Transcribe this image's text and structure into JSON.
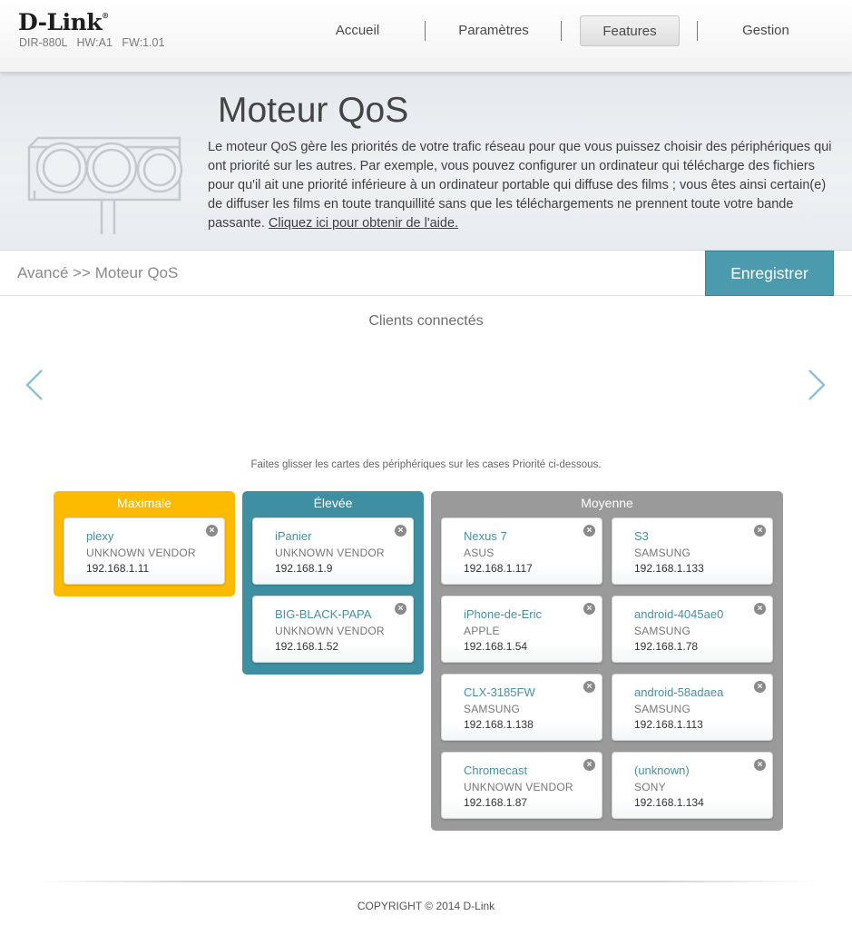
{
  "header": {
    "brand": "D-Link",
    "trademark": "®",
    "model": "DIR-880L",
    "hw": "HW:A1",
    "fw": "FW:1.01",
    "nav": [
      {
        "label": "Accueil"
      },
      {
        "label": "Paramètres"
      },
      {
        "label": "Features",
        "active": true
      },
      {
        "label": "Gestion"
      }
    ]
  },
  "intro": {
    "title": "Moteur QoS",
    "description": "Le moteur QoS gère les priorités de votre trafic réseau pour que vous puissez choisir des périphériques qui ont priorité sur les autres. Par exemple, vous pouvez configurer un ordinateur qui télécharge des fichiers pour qu'il ait une priorité inférieure à un ordinateur portable qui diffuse des films ; vous êtes ainsi certain(e) de diffuser les films en toute tranquillité sans que les téléchargements ne prennent toute votre bande passante.",
    "help_link": "Cliquez ici pour obtenir de l'aide.",
    "icon": "traffic-light-icon"
  },
  "breadcrumb": "Avancé >> Moteur QoS",
  "save_label": "Enregistrer",
  "clients": {
    "title": "Clients connectés",
    "prev_icon": "chevron-left-icon",
    "next_icon": "chevron-right-icon"
  },
  "hint": "Faites glisser les cartes des périphériques sur les cases Priorité ci-dessous.",
  "priorities": {
    "max": {
      "label": "Maximale",
      "color": "#fcbb00",
      "devices": [
        {
          "name": "plexy",
          "vendor": "UNKNOWN VENDOR",
          "ip": "192.168.1.11"
        }
      ]
    },
    "high": {
      "label": "Élevée",
      "color": "#3d8fa1",
      "devices": [
        {
          "name": "iPanier",
          "vendor": "UNKNOWN VENDOR",
          "ip": "192.168.1.9"
        },
        {
          "name": "BIG-BLACK-PAPA",
          "vendor": "UNKNOWN VENDOR",
          "ip": "192.168.1.52"
        }
      ]
    },
    "mid": {
      "label": "Moyenne",
      "color": "#9a9a9a",
      "devices": [
        {
          "name": "Nexus 7",
          "vendor": "ASUS",
          "ip": "192.168.1.117"
        },
        {
          "name": "S3",
          "vendor": "SAMSUNG",
          "ip": "192.168.1.133"
        },
        {
          "name": "iPhone-de-Eric",
          "vendor": "APPLE",
          "ip": "192.168.1.54"
        },
        {
          "name": "android-4045ae0",
          "vendor": "SAMSUNG",
          "ip": "192.168.1.78"
        },
        {
          "name": "CLX-3185FW",
          "vendor": "SAMSUNG",
          "ip": "192.168.1.138"
        },
        {
          "name": "android-58adaea",
          "vendor": "SAMSUNG",
          "ip": "192.168.1.113"
        },
        {
          "name": "Chromecast",
          "vendor": "UNKNOWN VENDOR",
          "ip": "192.168.1.87"
        },
        {
          "name": "(unknown)",
          "vendor": "SONY",
          "ip": "192.168.1.134"
        }
      ]
    }
  },
  "card_close_icon": "close-circle-icon",
  "footer": "COPYRIGHT © 2014 D-Link"
}
